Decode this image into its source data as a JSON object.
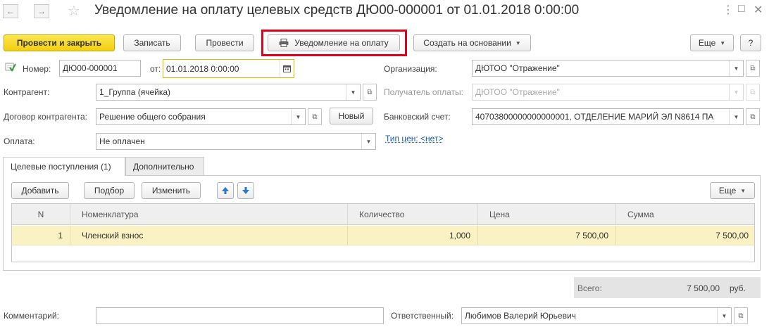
{
  "window": {
    "title": "Уведомление на оплату целевых средств ДЮ00-000001 от 01.01.2018 0:00:00",
    "controls": [
      "⋮",
      "□",
      "✕"
    ]
  },
  "toolbar": {
    "post_close": "Провести и закрыть",
    "write": "Записать",
    "post": "Провести",
    "notice": "Уведомление на оплату",
    "create_based": "Создать на основании",
    "more": "Еще",
    "help": "?"
  },
  "form": {
    "number_label": "Номер:",
    "number_value": "ДЮ00-000001",
    "date_label": "от:",
    "date_value": "01.01.2018  0:00:00",
    "org_label": "Организация:",
    "org_value": "ДЮТОО \"Отражение\"",
    "counterparty_label": "Контрагент:",
    "counterparty_value": "1_Группа (ячейка)",
    "recipient_label": "Получатель оплаты:",
    "recipient_value": "ДЮТОО \"Отражение\"",
    "contract_label": "Договор контрагента:",
    "contract_value": "Решение общего собрания",
    "new_button": "Новый",
    "bank_label": "Банковский счет:",
    "bank_value": "40703800000000000001, ОТДЕЛЕНИЕ МАРИЙ ЭЛ N8614 ПА",
    "payment_label": "Оплата:",
    "payment_value": "Не оплачен",
    "price_type_link": "Тип цен: <нет>"
  },
  "tabs": [
    {
      "label": "Целевые поступления (1)",
      "active": true
    },
    {
      "label": "Дополнительно",
      "active": false
    }
  ],
  "table_toolbar": {
    "add": "Добавить",
    "select": "Подбор",
    "edit": "Изменить",
    "more": "Еще"
  },
  "table": {
    "headers": [
      "N",
      "Номенклатура",
      "Количество",
      "Цена",
      "Сумма"
    ],
    "rows": [
      {
        "n": "1",
        "item": "Членский взнос",
        "qty": "1,000",
        "price": "7 500,00",
        "sum": "7 500,00"
      }
    ]
  },
  "totals": {
    "label": "Всего:",
    "value": "7 500,00",
    "currency": "руб."
  },
  "footer": {
    "comment_label": "Комментарий:",
    "comment_value": "",
    "responsible_label": "Ответственный:",
    "responsible_value": "Любимов Валерий Юрьевич"
  },
  "icons": [
    "back-arrow-icon",
    "forward-arrow-icon",
    "star-icon",
    "printer-icon",
    "calendar-icon",
    "open-form-icon",
    "dropdown-icon",
    "move-up-icon",
    "move-down-icon",
    "document-posted-icon"
  ]
}
